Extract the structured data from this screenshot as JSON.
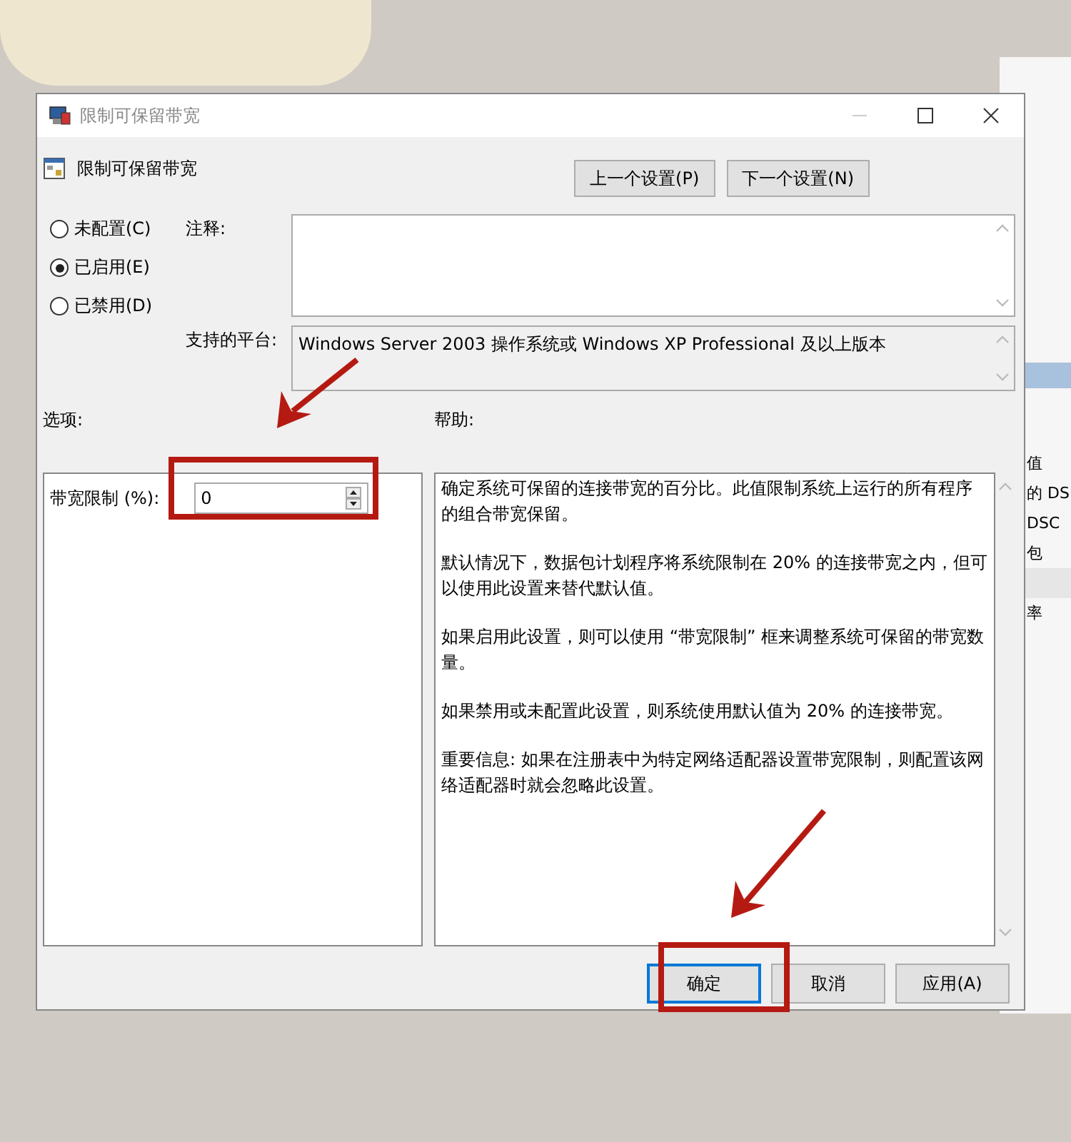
{
  "window": {
    "title": "限制可保留带宽"
  },
  "policy_name": "限制可保留带宽",
  "nav_buttons": [
    "上一个设置(P)",
    "下一个设置(N)"
  ],
  "state_options": [
    {
      "label": "未配置(C)",
      "selected": false
    },
    {
      "label": "已启用(E)",
      "selected": true
    },
    {
      "label": "已禁用(D)",
      "selected": false
    }
  ],
  "comment": {
    "label": "注释:"
  },
  "supported_on": {
    "label": "支持的平台:",
    "value": "Windows Server 2003 操作系统或 Windows XP Professional 及以上版本"
  },
  "options": {
    "label": "选项:",
    "fields": [
      {
        "label": "带宽限制 (%):",
        "value": "0"
      }
    ]
  },
  "help": {
    "label": "帮助:",
    "paragraphs": [
      "确定系统可保留的连接带宽的百分比。此值限制系统上运行的所有程序的组合带宽保留。",
      "默认情况下，数据包计划程序将系统限制在 20% 的连接带宽之内，但可以使用此设置来替代默认值。",
      "如果启用此设置，则可以使用 “带宽限制” 框来调整系统可保留的带宽数量。",
      "如果禁用或未配置此设置，则系统使用默认值为 20% 的连接带宽。",
      "重要信息: 如果在注册表中为特定网络适配器设置带宽限制，则配置该网络适配器时就会忽略此设置。"
    ]
  },
  "buttons": [
    {
      "label": "确定",
      "default": true
    },
    {
      "label": "取消",
      "default": false
    },
    {
      "label": "应用(A)",
      "default": false
    }
  ],
  "background_window": {
    "items": [
      {
        "text": "值",
        "selected": false
      },
      {
        "text": "的 DS",
        "selected": false
      },
      {
        "text": "DSC",
        "selected": false
      },
      {
        "text": "包",
        "selected": false
      },
      {
        "selected": true
      },
      {
        "text": "率",
        "selected": false
      }
    ]
  }
}
